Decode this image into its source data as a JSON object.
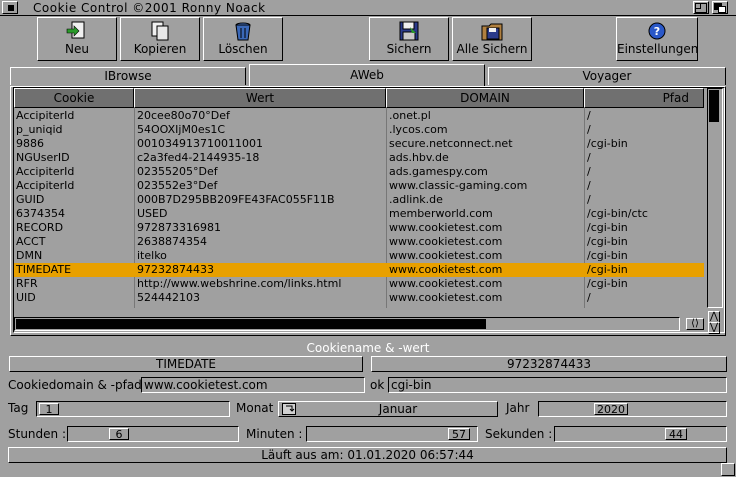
{
  "window": {
    "title": "Cookie Control ©2001 Ronny Noack"
  },
  "toolbar": {
    "new_label": "Neu",
    "copy_label": "Kopieren",
    "delete_label": "Löschen",
    "save_label": "Sichern",
    "save_all_label": "Alle Sichern",
    "settings_label": "Einstellungen"
  },
  "tabs": [
    {
      "label": "IBrowse",
      "active": false
    },
    {
      "label": "AWeb",
      "active": true
    },
    {
      "label": "Voyager",
      "active": false
    }
  ],
  "table": {
    "columns": [
      "Cookie",
      "Wert",
      "DOMAIN",
      "Pfad"
    ],
    "rows": [
      {
        "cookie": "AccipiterId",
        "wert": "20cee80o70°Def",
        "domain": ".onet.pl",
        "pfad": "/"
      },
      {
        "cookie": "p_uniqid",
        "wert": "54OOXIjM0es1C",
        "domain": ".lycos.com",
        "pfad": "/"
      },
      {
        "cookie": "9886",
        "wert": "001034913710011001",
        "domain": "secure.netconnect.net",
        "pfad": "/cgi-bin"
      },
      {
        "cookie": "NGUserID",
        "wert": "c2a3fed4-2144935-18",
        "domain": "ads.hbv.de",
        "pfad": "/"
      },
      {
        "cookie": "AccipiterId",
        "wert": "02355205°Def",
        "domain": "ads.gamespy.com",
        "pfad": "/"
      },
      {
        "cookie": "AccipiterId",
        "wert": "023552e3°Def",
        "domain": "www.classic-gaming.com",
        "pfad": "/"
      },
      {
        "cookie": "GUID",
        "wert": "000B7D295BB209FE43FAC055F11B",
        "domain": ".adlink.de",
        "pfad": "/"
      },
      {
        "cookie": "6374354",
        "wert": "USED",
        "domain": "memberworld.com",
        "pfad": "/cgi-bin/ctc"
      },
      {
        "cookie": "RECORD",
        "wert": "972873316981",
        "domain": "www.cookietest.com",
        "pfad": "/cgi-bin"
      },
      {
        "cookie": "ACCT",
        "wert": "2638874354",
        "domain": "www.cookietest.com",
        "pfad": "/cgi-bin"
      },
      {
        "cookie": "DMN",
        "wert": "itelko",
        "domain": "www.cookietest.com",
        "pfad": "/cgi-bin"
      },
      {
        "cookie": "TIMEDATE",
        "wert": "97232874433",
        "domain": "www.cookietest.com",
        "pfad": "/cgi-bin",
        "selected": true
      },
      {
        "cookie": "RFR",
        "wert": "http://www.webshrine.com/links.html",
        "domain": "www.cookietest.com",
        "pfad": "/cgi-bin"
      },
      {
        "cookie": "UID",
        "wert": "524442103",
        "domain": "www.cookietest.com",
        "pfad": "/"
      }
    ]
  },
  "scroll_arrows": {
    "left_right": "⟨⟩",
    "up": "⋀",
    "down": "⋁"
  },
  "detail": {
    "section_label": "Cookiename & -wert",
    "name_value": "TIMEDATE",
    "value_value": "97232874433",
    "domain_path_label": "Cookiedomain & -pfad",
    "domain_value": "www.cookietest.com",
    "ok_label": "ok",
    "path_value": "cgi-bin",
    "day_label": "Tag",
    "day_value": "1",
    "month_label": "Monat",
    "month_value": "Januar",
    "year_label": "Jahr",
    "year_value": "2020",
    "hours_label": "Stunden :",
    "hours_value": "6",
    "minutes_label": "Minuten :",
    "minutes_value": "57",
    "seconds_label": "Sekunden :",
    "seconds_value": "44",
    "expires_text": "Läuft aus am: 01.01.2020 06:57:44"
  },
  "colors": {
    "background": "#a0a0a0",
    "header": "#707070",
    "selection": "#e8a000",
    "label_white": "#ffffff"
  },
  "icons": [
    "close-icon",
    "zoom-icon",
    "depth-icon",
    "new-icon",
    "copy-icon",
    "trash-icon",
    "floppy-disk-icon",
    "floppy-folder-icon",
    "question-icon"
  ]
}
